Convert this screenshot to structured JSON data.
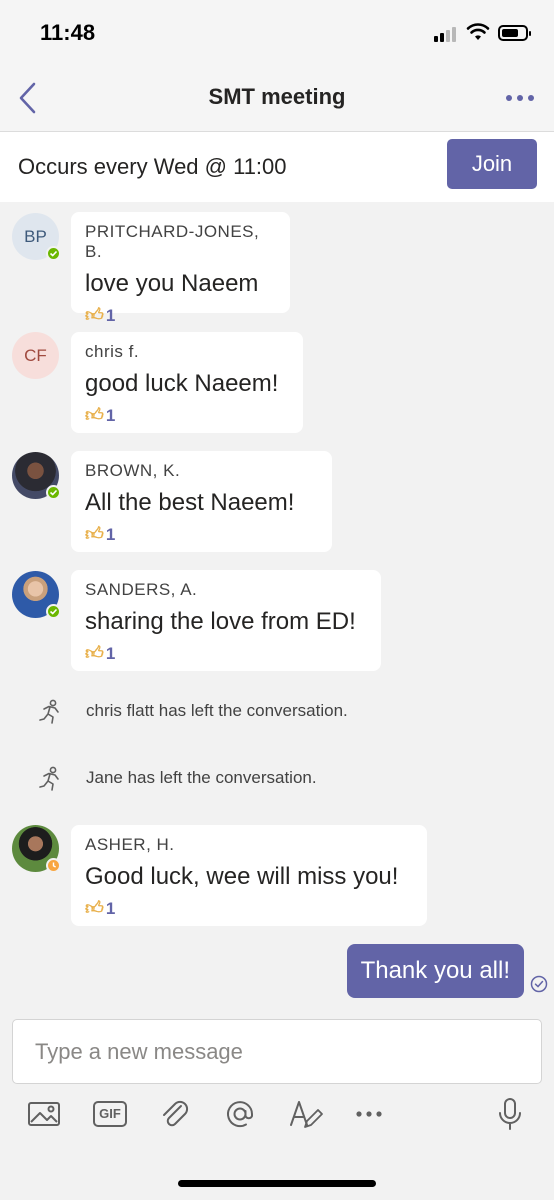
{
  "status_bar": {
    "time": "11:48"
  },
  "nav": {
    "title": "SMT meeting"
  },
  "banner": {
    "text": "Occurs every Wed @ 11:00",
    "join_label": "Join"
  },
  "messages": [
    {
      "initials": "BP",
      "sender": "PRITCHARD-JONES, B.",
      "text": "love you Naeem",
      "reaction_count": "1",
      "presence": "available"
    },
    {
      "initials": "CF",
      "sender": "chris f.",
      "text": "good luck Naeem!",
      "reaction_count": "1",
      "presence": ""
    },
    {
      "initials": "",
      "sender": "BROWN, K.",
      "text": "All the best Naeem!",
      "reaction_count": "1",
      "presence": "available"
    },
    {
      "initials": "",
      "sender": "SANDERS, A.",
      "text": "sharing the love from ED!",
      "reaction_count": "1",
      "presence": "available"
    },
    {
      "initials": "",
      "sender": "ASHER, H.",
      "text": "Good luck, wee will miss you!",
      "reaction_count": "1",
      "presence": "away"
    }
  ],
  "system_events": [
    {
      "text": "chris flatt has left the conversation.",
      "icon": "person-leaving-icon"
    },
    {
      "text": "Jane has left the conversation.",
      "icon": "person-leaving-icon"
    }
  ],
  "my_message": {
    "text": "Thank you all!",
    "status": "read"
  },
  "compose": {
    "placeholder": "Type a new message"
  },
  "toolbar": {
    "icons": [
      "image-icon",
      "gif-icon",
      "attach-icon",
      "mention-icon",
      "format-icon",
      "more-icon",
      "microphone-icon"
    ],
    "gif_label": "GIF"
  },
  "colors": {
    "accent": "#6264a7",
    "available": "#6bb700",
    "away": "#f8a640",
    "background": "#f2f2f2"
  }
}
